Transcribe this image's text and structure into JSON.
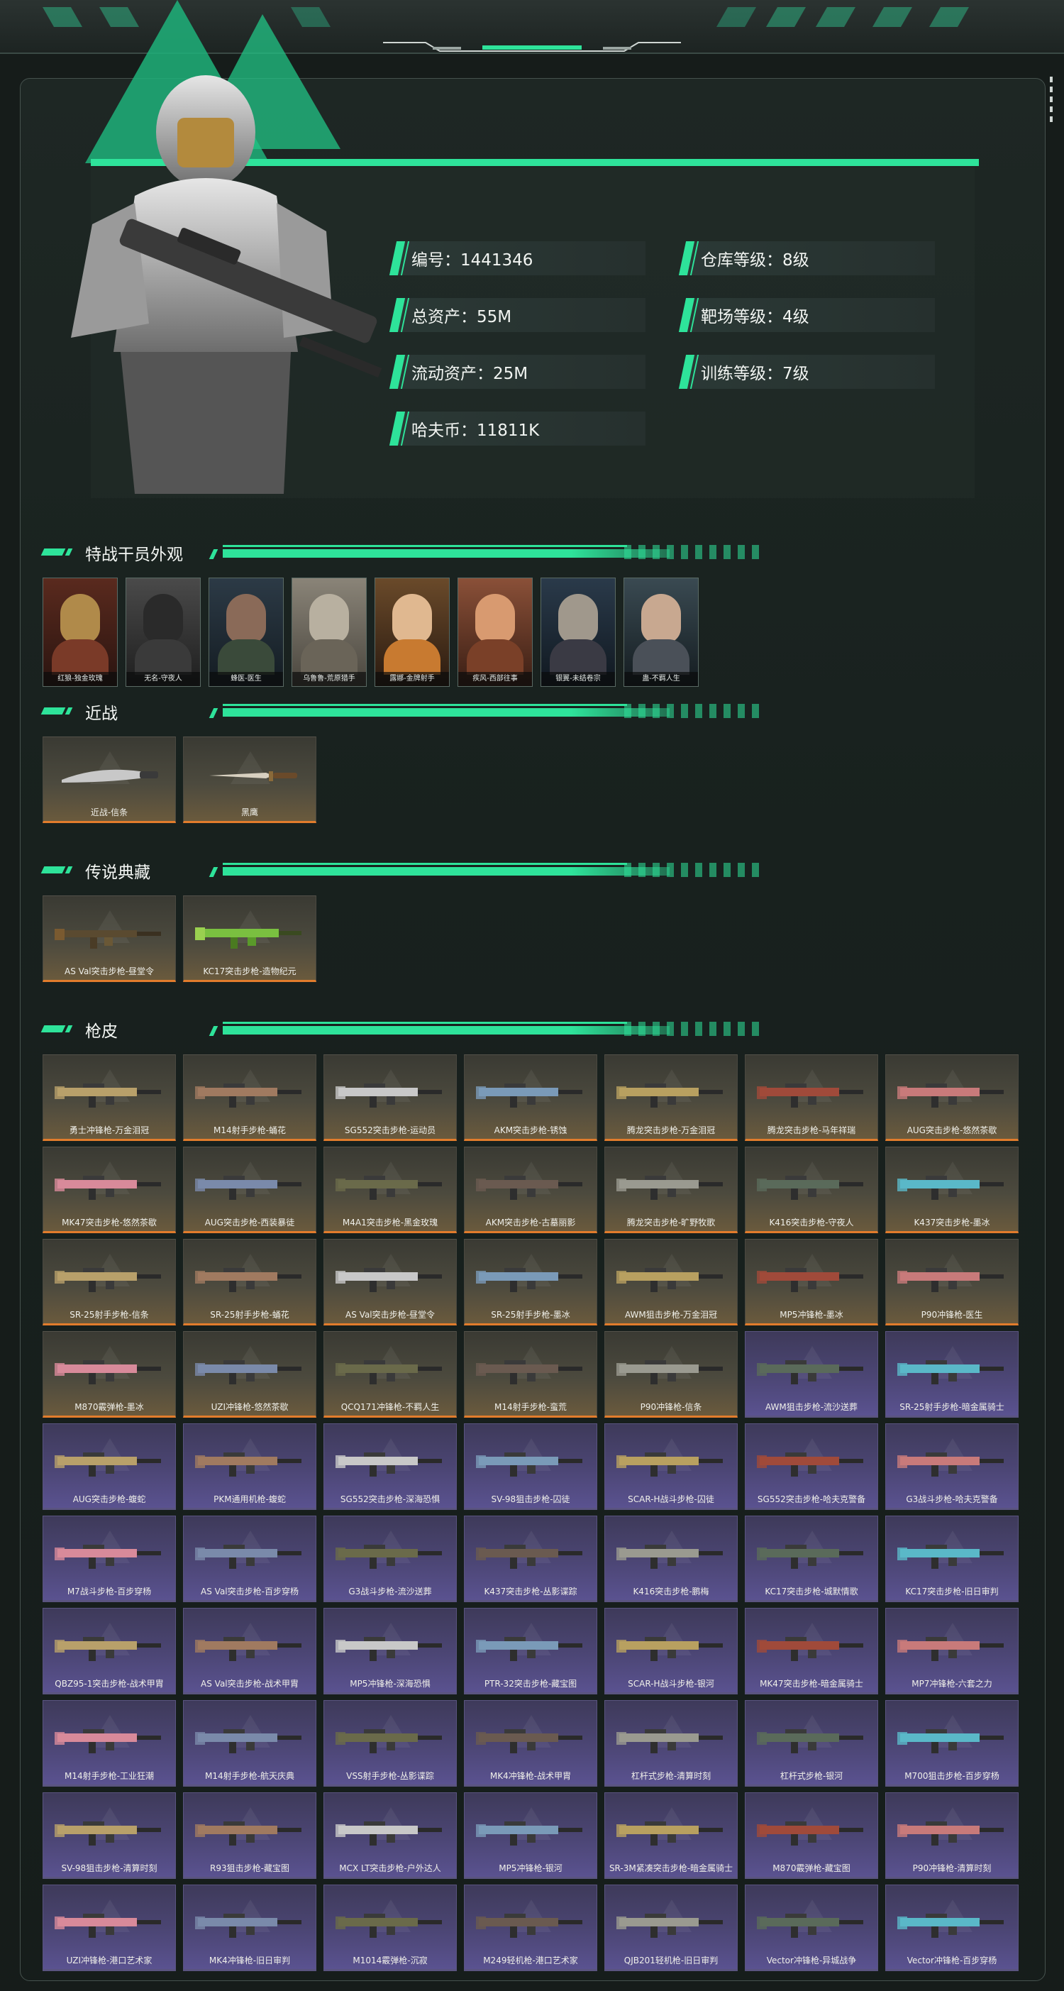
{
  "profile": {
    "stats_left": [
      {
        "label": "编号：1441346"
      },
      {
        "label": "总资产：55M"
      },
      {
        "label": "流动资产：25M"
      },
      {
        "label": "哈夫币：11811K"
      }
    ],
    "stats_right": [
      {
        "label": "仓库等级：8级"
      },
      {
        "label": "靶场等级：4级"
      },
      {
        "label": "训练等级：7级"
      }
    ]
  },
  "sections": {
    "operators_title": "特战干员外观",
    "melee_title": "近战",
    "legend_title": "传说典藏",
    "skins_title": "枪皮"
  },
  "operators": [
    {
      "label": "红狼-独金玫瑰"
    },
    {
      "label": "无名-守夜人"
    },
    {
      "label": "蜂医-医生"
    },
    {
      "label": "乌鲁鲁-荒原猎手"
    },
    {
      "label": "露娜-金牌射手"
    },
    {
      "label": "疾风-西部往事"
    },
    {
      "label": "银翼-未结卷宗"
    },
    {
      "label": "蛊-不羁人生"
    }
  ],
  "melee": [
    {
      "label": "近战-信条"
    },
    {
      "label": "黑鹰"
    }
  ],
  "legend": [
    {
      "label": "AS Val突击步枪-昼堂令"
    },
    {
      "label": "KC17突击步枪-造物纪元"
    }
  ],
  "gun_skins": [
    [
      "勇士冲锋枪-万金泪冠",
      "M14射手步枪-蛹花",
      "SG552突击步枪-运动员",
      "AKM突击步枪-锈蚀",
      "腾龙突击步枪-万金泪冠",
      "腾龙突击步枪-马年祥瑞",
      "AUG突击步枪-悠然茶歇"
    ],
    [
      "MK47突击步枪-悠然茶歇",
      "AUG突击步枪-西装暴徒",
      "M4A1突击步枪-黑金玫瑰",
      "AKM突击步枪-古墓丽影",
      "腾龙突击步枪-旷野牧歌",
      "K416突击步枪-守夜人",
      "K437突击步枪-墨冰"
    ],
    [
      "SR-25射手步枪-信条",
      "SR-25射手步枪-蛹花",
      "AS Val突击步枪-昼堂令",
      "SR-25射手步枪-墨冰",
      "AWM狙击步枪-万金泪冠",
      "MP5冲锋枪-墨冰",
      "P90冲锋枪-医生"
    ],
    [
      "M870霰弹枪-墨冰",
      "UZI冲锋枪-悠然茶歇",
      "QCQ171冲锋枪-不羁人生",
      "M14射手步枪-蛮荒",
      "P90冲锋枪-信条",
      "AWM狙击步枪-流沙送葬",
      "SR-25射手步枪-暗金属骑士"
    ],
    [
      "AUG突击步枪-蝮蛇",
      "PKM通用机枪-蝮蛇",
      "SG552突击步枪-深海恐惧",
      "SV-98狙击步枪-囚徒",
      "SCAR-H战斗步枪-囚徒",
      "SG552突击步枪-哈夫克警备",
      "G3战斗步枪-哈夫克警备"
    ],
    [
      "M7战斗步枪-百步穿杨",
      "AS Val突击步枪-百步穿杨",
      "G3战斗步枪-流沙送葬",
      "K437突击步枪-丛影谍踪",
      "K416突击步枪-鹏梅",
      "KC17突击步枪-城默情歌",
      "KC17突击步枪-旧日审判"
    ],
    [
      "QBZ95-1突击步枪-战术甲胄",
      "AS Val突击步枪-战术甲胄",
      "MP5冲锋枪-深海恐惧",
      "PTR-32突击步枪-藏宝图",
      "SCAR-H战斗步枪-银河",
      "MK47突击步枪-暗金属骑士",
      "MP7冲锋枪-六套之力"
    ],
    [
      "M14射手步枪-工业狂潮",
      "M14射手步枪-航天庆典",
      "VSS射手步枪-丛影谍踪",
      "MK4冲锋枪-战术甲胄",
      "杠杆式步枪-清算时刻",
      "杠杆式步枪-银河",
      "M700狙击步枪-百步穿杨"
    ],
    [
      "SV-98狙击步枪-清算时刻",
      "R93狙击步枪-藏宝图",
      "MCX LT突击步枪-户外达人",
      "MP5冲锋枪-银河",
      "SR-3M紧凑突击步枪-暗金属骑士",
      "M870霰弹枪-藏宝图",
      "P90冲锋枪-清算时刻"
    ],
    [
      "UZI冲锋枪-港口艺术家",
      "MK4冲锋枪-旧日审判",
      "M1014霰弹枪-沉寂",
      "M249轻机枪-港口艺术家",
      "QJB201轻机枪-旧日审判",
      "Vector冲锋枪-异城战争",
      "Vector冲锋枪-百步穿杨"
    ]
  ],
  "colors": {
    "accent": "#2ee39a",
    "gold_border": "#e27c2c",
    "purple_border": "#8a72d8"
  }
}
